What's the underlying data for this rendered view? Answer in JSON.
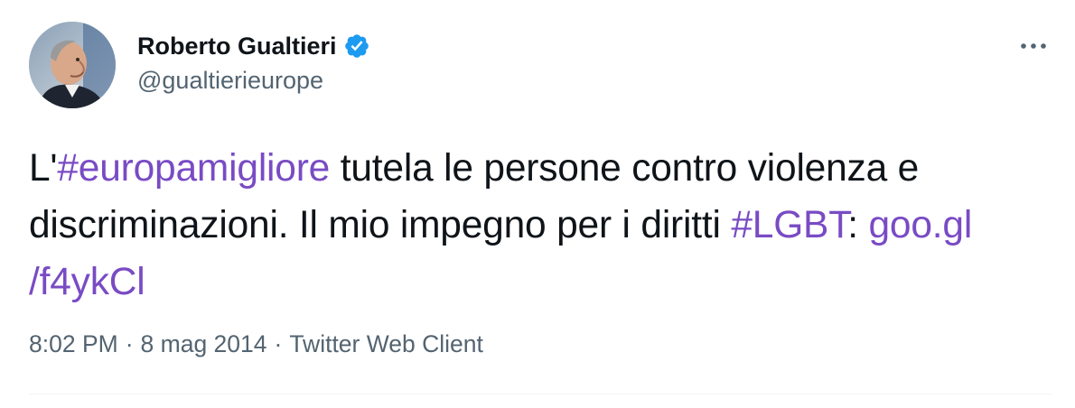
{
  "author": {
    "display_name": "Roberto Gualtieri",
    "handle": "@gualtierieurope",
    "verified": true,
    "avatar_icon": "profile-photo"
  },
  "menu": {
    "icon": "more-horizontal-icon"
  },
  "tweet": {
    "line1": {
      "prefix": "L'",
      "hashtag": "#europamigliore",
      "suffix": " tutela le persone contro violenza e"
    },
    "line2": {
      "text": "discriminazioni. Il mio impegno per i diritti ",
      "hashtag": "#LGBT",
      "colon": ": ",
      "link_part1": "goo.gl"
    },
    "line3": {
      "link_part2": "/f4ykCl"
    }
  },
  "meta": {
    "time": "8:02 PM",
    "separator": "·",
    "date": "8 mag 2014",
    "source": "Twitter Web Client"
  },
  "colors": {
    "link": "#794bc4",
    "verified_badge": "#1d9bf0",
    "text": "#0f1419",
    "secondary": "#536471"
  }
}
